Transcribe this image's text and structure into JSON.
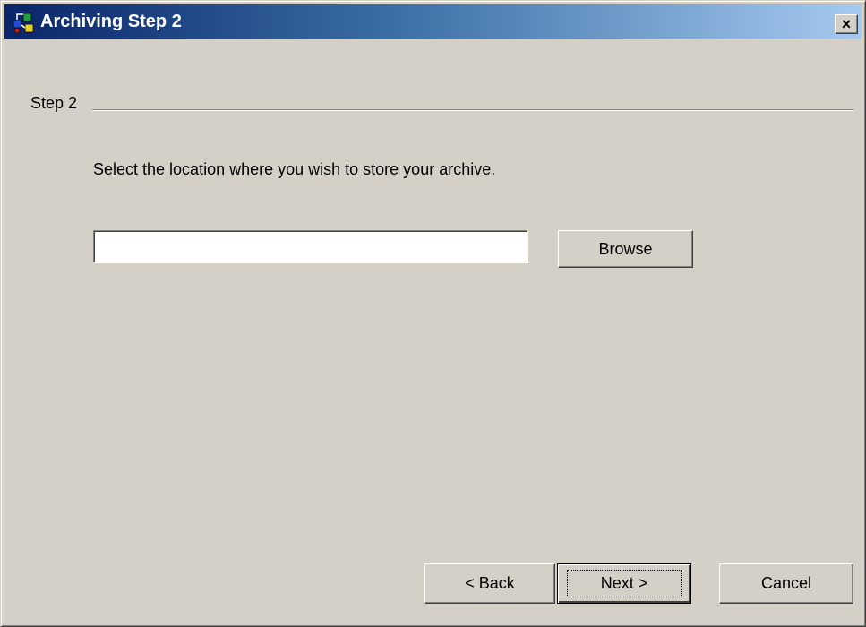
{
  "window": {
    "title": "Archiving Step 2",
    "close_label": "×"
  },
  "group": {
    "label": "Step 2"
  },
  "content": {
    "instruction": "Select the location where you wish to store your archive.",
    "path_value": "",
    "path_placeholder": ""
  },
  "buttons": {
    "browse": "Browse",
    "back": "< Back",
    "next": "Next >",
    "cancel": "Cancel"
  },
  "colors": {
    "titlebar_start": "#0a246a",
    "titlebar_end": "#a6caf0",
    "dialog_bg": "#d4d0c8"
  },
  "icons": {
    "app": "archive-wizard-icon",
    "close": "close-icon"
  }
}
